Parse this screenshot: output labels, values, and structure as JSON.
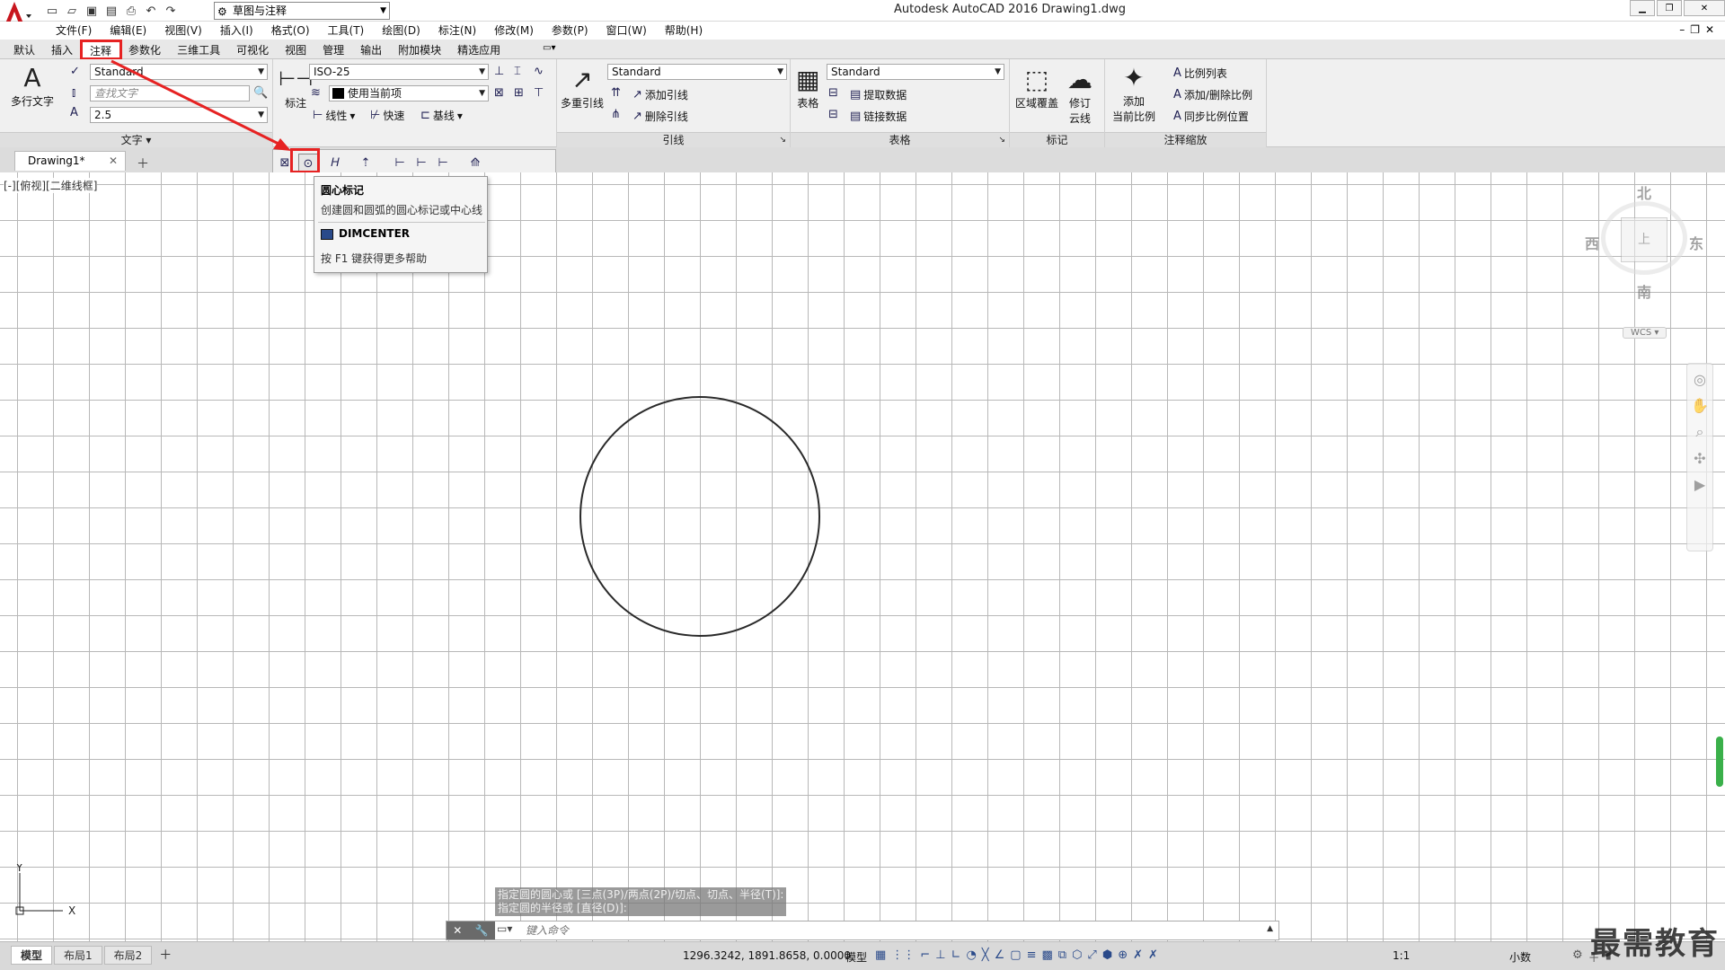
{
  "titlebar": {
    "workspace": "草图与注释",
    "app_title": "Autodesk AutoCAD 2016    Drawing1.dwg"
  },
  "menu": [
    "文件(F)",
    "编辑(E)",
    "视图(V)",
    "插入(I)",
    "格式(O)",
    "工具(T)",
    "绘图(D)",
    "标注(N)",
    "修改(M)",
    "参数(P)",
    "窗口(W)",
    "帮助(H)"
  ],
  "ribbon_tabs": [
    "默认",
    "插入",
    "注释",
    "参数化",
    "三维工具",
    "可视化",
    "视图",
    "管理",
    "输出",
    "附加模块",
    "精选应用"
  ],
  "ribbon_active_tab": "注释",
  "panels": {
    "text": {
      "title": "文字",
      "big_button": "多行文字",
      "style": "Standard",
      "find_placeholder": "查找文字",
      "height": "2.5"
    },
    "dim": {
      "big_button": "标注",
      "style": "ISO-25",
      "layer": "使用当前项",
      "linear": "线性",
      "quick": "快速",
      "baseline": "基线"
    },
    "leader": {
      "title": "引线",
      "big_button": "多重引线",
      "style": "Standard",
      "add": "添加引线",
      "remove": "删除引线"
    },
    "table": {
      "title": "表格",
      "big_button": "表格",
      "style": "Standard",
      "extract": "提取数据",
      "link": "链接数据"
    },
    "markup": {
      "title": "标记",
      "wipeout": "区域覆盖",
      "revcloud": "修订",
      "revcloud2": "云线"
    },
    "scale": {
      "title": "注释缩放",
      "add1": "添加",
      "add2": "当前比例",
      "list": "比例列表",
      "add_delete": "添加/删除比例",
      "sync": "同步比例位置"
    }
  },
  "doc_tab": "Drawing1*",
  "tooltip": {
    "title": "圆心标记",
    "description": "创建圆和圆弧的圆心标记或中心线",
    "command": "DIMCENTER",
    "help": "按 F1 键获得更多帮助"
  },
  "viewport_label": "[-][俯视][二维线框]",
  "viewcube": {
    "north": "北",
    "south": "南",
    "west": "西",
    "east": "东",
    "face": "上",
    "wcs": "WCS"
  },
  "command": {
    "history1": "指定圆的圆心或 [三点(3P)/两点(2P)/切点、切点、半径(T)]:",
    "history2": "指定圆的半径或 [直径(D)]:",
    "placeholder": "键入命令"
  },
  "layout_tabs": [
    "模型",
    "布局1",
    "布局2"
  ],
  "status": {
    "coords": "1296.3242, 1891.8658, 0.0000",
    "model": "模型",
    "scale": "1:1",
    "units": "小数"
  },
  "watermark": "最需教育",
  "colors": {
    "highlight": "#e62222",
    "grid": "#b8b8b8"
  }
}
